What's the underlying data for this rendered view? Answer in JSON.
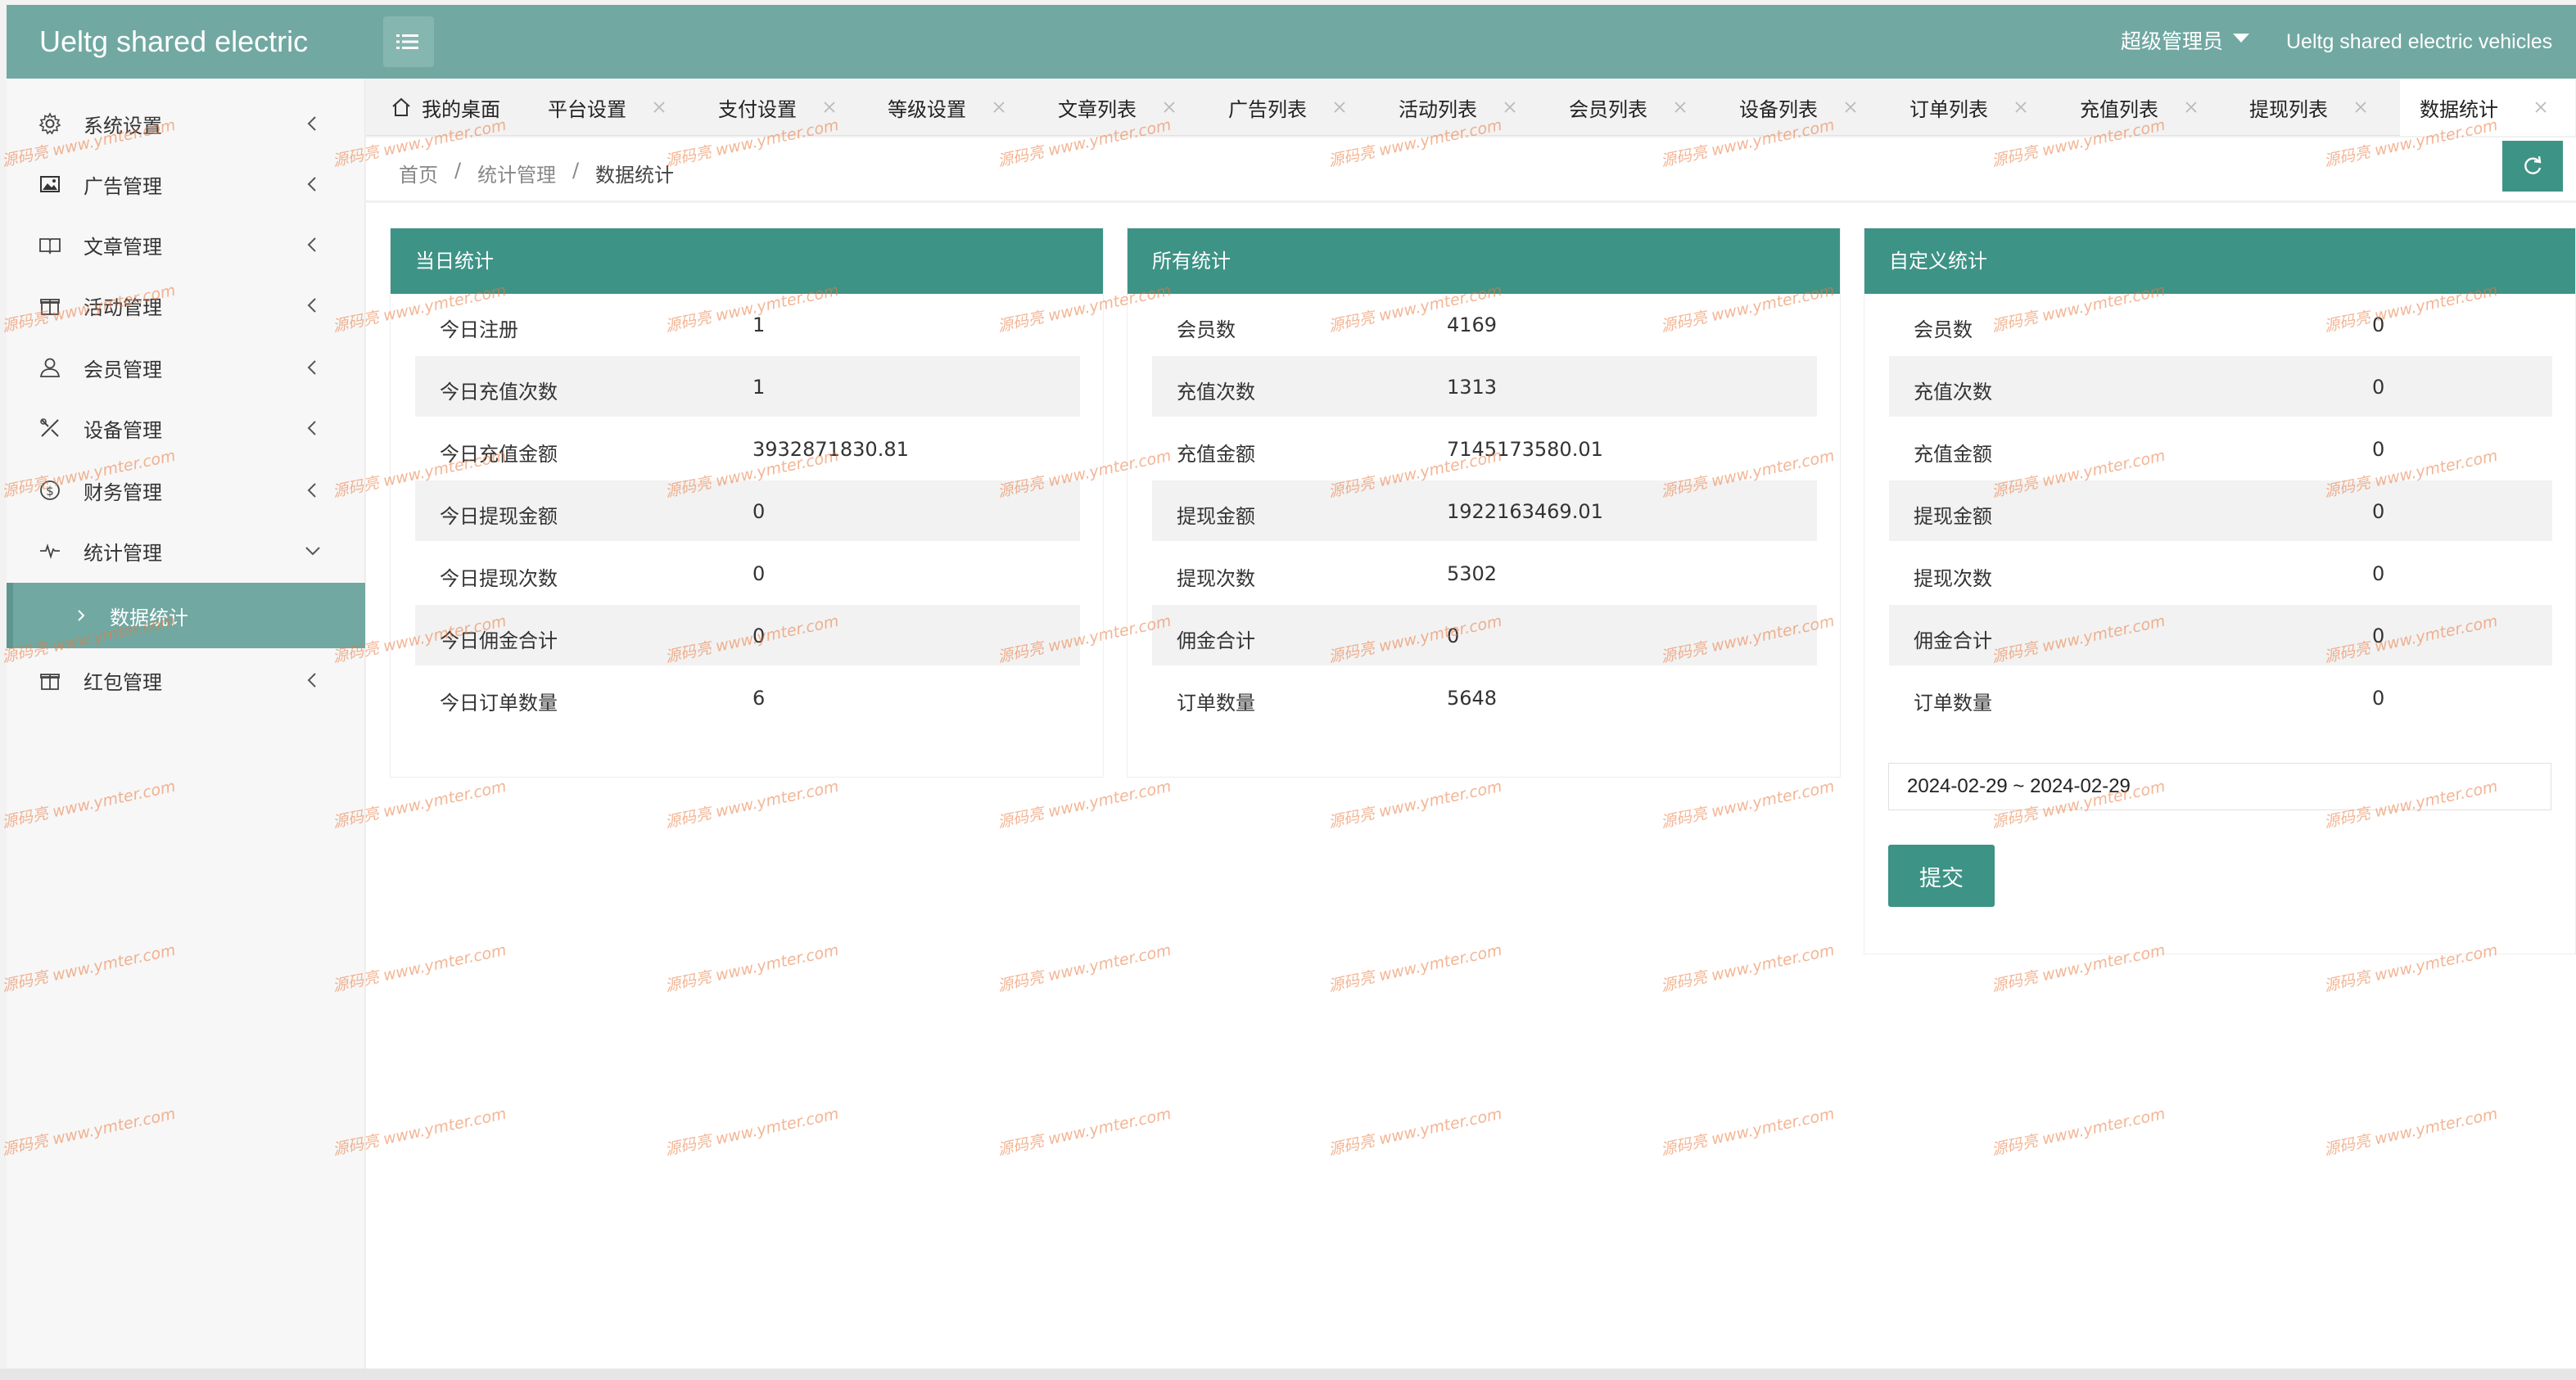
{
  "header": {
    "brand": "Ueltg shared electric",
    "admin_label": "超级管理员",
    "app_name": "Ueltg shared electric vehicles"
  },
  "sidebar": {
    "items": [
      {
        "label": "系统设置",
        "icon": "gear-icon"
      },
      {
        "label": "广告管理",
        "icon": "image-icon"
      },
      {
        "label": "文章管理",
        "icon": "book-icon"
      },
      {
        "label": "活动管理",
        "icon": "gift-icon"
      },
      {
        "label": "会员管理",
        "icon": "user-icon"
      },
      {
        "label": "设备管理",
        "icon": "tools-icon"
      },
      {
        "label": "财务管理",
        "icon": "dollar-icon"
      },
      {
        "label": "统计管理",
        "icon": "pulse-icon"
      },
      {
        "label": "数据统计",
        "icon": "chevron-right-icon"
      },
      {
        "label": "红包管理",
        "icon": "gift-icon"
      }
    ]
  },
  "tabs": [
    {
      "label": "我的桌面"
    },
    {
      "label": "平台设置"
    },
    {
      "label": "支付设置"
    },
    {
      "label": "等级设置"
    },
    {
      "label": "文章列表"
    },
    {
      "label": "广告列表"
    },
    {
      "label": "活动列表"
    },
    {
      "label": "会员列表"
    },
    {
      "label": "设备列表"
    },
    {
      "label": "订单列表"
    },
    {
      "label": "充值列表"
    },
    {
      "label": "提现列表"
    },
    {
      "label": "数据统计",
      "active": true
    }
  ],
  "breadcrumb": {
    "home": "首页",
    "sep": "/",
    "section": "统计管理",
    "current": "数据统计"
  },
  "panels": {
    "today": {
      "title": "当日统计",
      "rows": [
        {
          "label": "今日注册",
          "value": "1"
        },
        {
          "label": "今日充值次数",
          "value": "1"
        },
        {
          "label": "今日充值金额",
          "value": "3932871830.81"
        },
        {
          "label": "今日提现金额",
          "value": "0"
        },
        {
          "label": "今日提现次数",
          "value": "0"
        },
        {
          "label": "今日佣金合计",
          "value": "0"
        },
        {
          "label": "今日订单数量",
          "value": "6"
        }
      ]
    },
    "all": {
      "title": "所有统计",
      "rows": [
        {
          "label": "会员数",
          "value": "4169"
        },
        {
          "label": "充值次数",
          "value": "1313"
        },
        {
          "label": "充值金额",
          "value": "7145173580.01"
        },
        {
          "label": "提现金额",
          "value": "1922163469.01"
        },
        {
          "label": "提现次数",
          "value": "5302"
        },
        {
          "label": "佣金合计",
          "value": "0"
        },
        {
          "label": "订单数量",
          "value": "5648"
        }
      ]
    },
    "custom": {
      "title": "自定义统计",
      "rows": [
        {
          "label": "会员数",
          "value": "0"
        },
        {
          "label": "充值次数",
          "value": "0"
        },
        {
          "label": "充值金额",
          "value": "0"
        },
        {
          "label": "提现金额",
          "value": "0"
        },
        {
          "label": "提现次数",
          "value": "0"
        },
        {
          "label": "佣金合计",
          "value": "0"
        },
        {
          "label": "订单数量",
          "value": "0"
        }
      ],
      "date_range": "2024-02-29 ~ 2024-02-29",
      "submit_label": "提交"
    }
  },
  "watermark": {
    "text": "源码亮 www.ymter.com"
  },
  "colors": {
    "header": "#71a8a2",
    "accent": "#3d9386",
    "sidebar_active": "#71a8a2"
  }
}
